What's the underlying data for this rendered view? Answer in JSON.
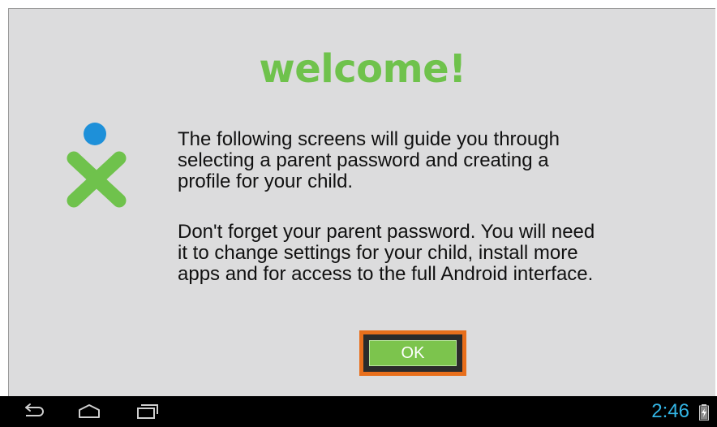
{
  "dialog": {
    "title": "welcome!",
    "paragraph1": [
      "The following screens will guide you through",
      "selecting a parent password and creating a",
      "profile for your child."
    ],
    "paragraph2": [
      "Don't forget your parent password. You will need",
      "it to change settings for your child, install more",
      "apps and for access to the full Android interface."
    ],
    "ok_label": "OK"
  },
  "logo": {
    "icon": "xo-person-logo",
    "colors": {
      "head": "#1e90d9",
      "body": "#6fc24c"
    }
  },
  "navbar": {
    "back_icon": "back-icon",
    "home_icon": "home-icon",
    "recent_icon": "recent-apps-icon",
    "clock": "2:46",
    "battery_icon": "battery-charging-icon"
  },
  "colors": {
    "accent_green": "#6fc24c",
    "focus_orange": "#e86f1c",
    "clock_blue": "#33b5e5",
    "background": "#dcdcdd"
  }
}
